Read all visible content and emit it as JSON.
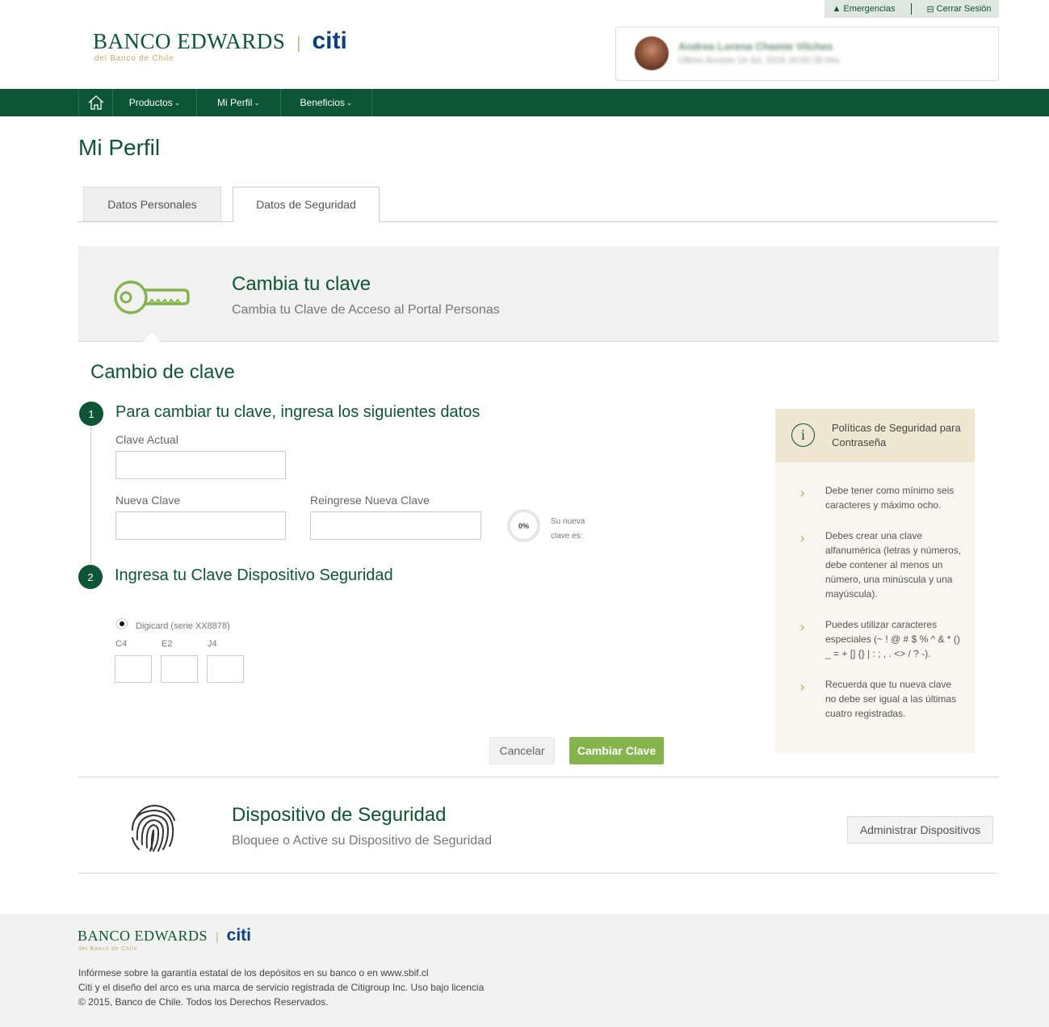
{
  "utility": {
    "emergencias": "Emergencias",
    "cerrar_sesion": "Cerrar Sesión"
  },
  "brand": {
    "name": "BANCO EDWARDS",
    "sep": "|",
    "citi": "citi",
    "sub": "del Banco de Chile"
  },
  "user": {
    "name": "Andrea Lorena Chamie Vilches",
    "last_access": "Último Acceso 14 Jul, 2016 10:32:28 Hrs."
  },
  "nav": {
    "items": [
      "Productos",
      "Mi Perfil",
      "Beneficios"
    ]
  },
  "page": {
    "title": "Mi Perfil"
  },
  "tabs": [
    "Datos Personales",
    "Datos de Seguridad"
  ],
  "banner": {
    "title": "Cambia tu clave",
    "subtitle": "Cambia tu Clave de Acceso al Portal Personas"
  },
  "form": {
    "section_title": "Cambio de clave",
    "step1_number": "1",
    "step1_title": "Para cambiar tu clave, ingresa los siguientes datos",
    "current_label": "Clave Actual",
    "new_label": "Nueva Clave",
    "repeat_label": "Reingrese Nueva Clave",
    "strength_value": "0%",
    "strength_text": "Su nueva clave es:",
    "step2_number": "2",
    "step2_title": "Ingresa tu Clave Dispositivo Seguridad",
    "device_option": "Digicard (serie XX8878)",
    "coords": [
      "C4",
      "E2",
      "J4"
    ],
    "cancel": "Cancelar",
    "submit": "Cambiar Clave"
  },
  "policies": {
    "icon": "i",
    "title": "Políticas de Seguridad para Contraseña",
    "items": [
      "Debe tener como mínimo seis caracteres y máximo ocho.",
      "Debes crear una clave alfanumérica (letras y números, debe contener al menos un número, una minúscula y una mayúscula).",
      "Puedes utilizar caracteres especiales (~ ! @ # $ % ^ & * () _ = + [] {} | : ; , . <> / ? -).",
      "Recuerda que tu nueva clave no debe ser igual a las últimas cuatro registradas."
    ]
  },
  "device": {
    "title": "Dispositivo de Seguridad",
    "subtitle": "Bloquee o Active su Dispositivo de Seguridad",
    "button": "Administrar Dispositivos"
  },
  "footer": {
    "line1": "Infórmese sobre la garantía estatal de los depósitos en su banco o en www.sbif.cl",
    "line2": "Citi y el diseño del arco es una marca de servicio registrada de Citigroup Inc. Uso bajo licencia",
    "line3": "© 2015, Banco de Chile. Todos los Derechos Reservados."
  },
  "colors": {
    "brand_green": "#0c5537",
    "accent_green": "#86b44c",
    "gold": "#c3a96b",
    "citi_blue": "#0a3f86"
  }
}
